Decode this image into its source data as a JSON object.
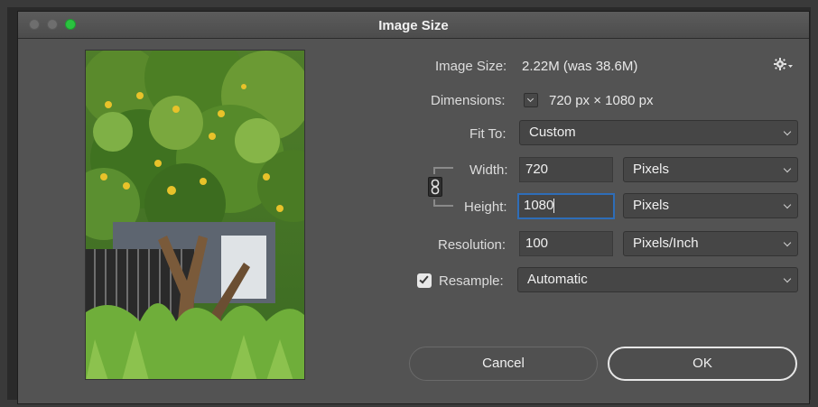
{
  "window": {
    "title": "Image Size"
  },
  "info": {
    "image_size_label": "Image Size:",
    "image_size_value": "2.22M (was 38.6M)",
    "dimensions_label": "Dimensions:",
    "dimensions_value": "720 px  ×  1080 px"
  },
  "fit_to": {
    "label": "Fit To:",
    "value": "Custom"
  },
  "width": {
    "label": "Width:",
    "value": "720",
    "unit": "Pixels"
  },
  "height": {
    "label": "Height:",
    "value": "1080",
    "unit": "Pixels"
  },
  "resolution": {
    "label": "Resolution:",
    "value": "100",
    "unit": "Pixels/Inch"
  },
  "resample": {
    "label": "Resample:",
    "checked": true,
    "value": "Automatic"
  },
  "buttons": {
    "cancel": "Cancel",
    "ok": "OK"
  },
  "icons": {
    "gear": "gear-icon",
    "link": "link-icon"
  },
  "colors": {
    "dialog_bg": "#535353",
    "field_bg": "#454545",
    "focus_border": "#2e6db8",
    "maximize_green": "#2ac23f"
  }
}
